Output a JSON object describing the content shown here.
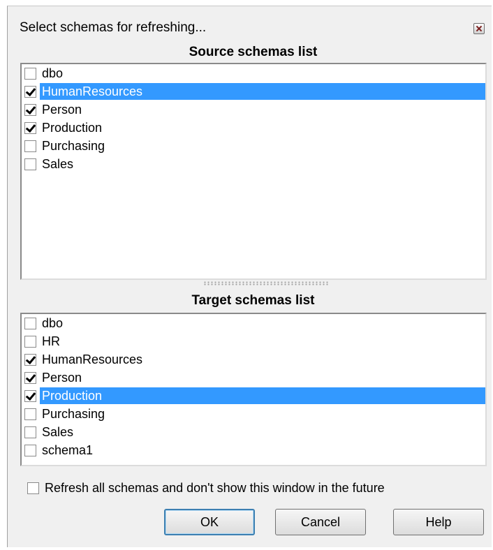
{
  "window": {
    "title": "Select schemas for refreshing..."
  },
  "source": {
    "title": "Source schemas list",
    "items": [
      {
        "label": "dbo",
        "checked": false,
        "selected": false
      },
      {
        "label": "HumanResources",
        "checked": true,
        "selected": true
      },
      {
        "label": "Person",
        "checked": true,
        "selected": false
      },
      {
        "label": "Production",
        "checked": true,
        "selected": false
      },
      {
        "label": "Purchasing",
        "checked": false,
        "selected": false
      },
      {
        "label": "Sales",
        "checked": false,
        "selected": false
      }
    ]
  },
  "target": {
    "title": "Target schemas list",
    "items": [
      {
        "label": "dbo",
        "checked": false,
        "selected": false
      },
      {
        "label": "HR",
        "checked": false,
        "selected": false
      },
      {
        "label": "HumanResources",
        "checked": true,
        "selected": false
      },
      {
        "label": "Person",
        "checked": true,
        "selected": false
      },
      {
        "label": "Production",
        "checked": true,
        "selected": true
      },
      {
        "label": "Purchasing",
        "checked": false,
        "selected": false
      },
      {
        "label": "Sales",
        "checked": false,
        "selected": false
      },
      {
        "label": "schema1",
        "checked": false,
        "selected": false
      }
    ]
  },
  "footer": {
    "refresh_all_label": "Refresh all schemas and don't show this window in the future",
    "refresh_all_checked": false
  },
  "buttons": {
    "ok": "OK",
    "cancel": "Cancel",
    "help": "Help"
  }
}
